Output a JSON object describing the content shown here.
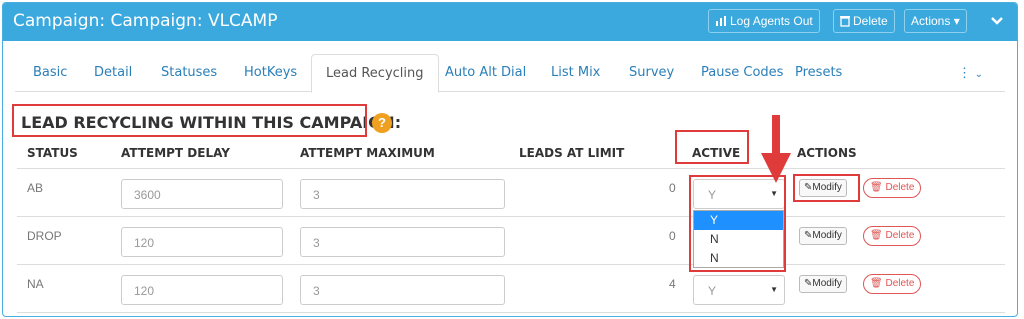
{
  "header": {
    "title": "Campaign: Campaign: VLCAMP",
    "log_agents_out": "Log Agents Out",
    "delete": "Delete",
    "actions": "Actions"
  },
  "tabs": [
    {
      "label": "Basic"
    },
    {
      "label": "Detail"
    },
    {
      "label": "Statuses"
    },
    {
      "label": "HotKeys"
    },
    {
      "label": "Lead Recycling"
    },
    {
      "label": "Auto Alt Dial"
    },
    {
      "label": "List Mix"
    },
    {
      "label": "Survey"
    },
    {
      "label": "Pause Codes"
    },
    {
      "label": "Presets"
    }
  ],
  "section": {
    "title": "LEAD RECYCLING WITHIN THIS CAMPAIGN:",
    "help": "?"
  },
  "table": {
    "headers": {
      "status": "STATUS",
      "attempt_delay": "ATTEMPT DELAY",
      "attempt_maximum": "ATTEMPT MAXIMUM",
      "leads_at_limit": "LEADS AT LIMIT",
      "active": "ACTIVE",
      "actions": "ACTIONS"
    },
    "rows": [
      {
        "status": "AB",
        "delay": "3600",
        "max": "3",
        "leads": "0",
        "active": "Y"
      },
      {
        "status": "DROP",
        "delay": "120",
        "max": "3",
        "leads": "0",
        "active": "Y"
      },
      {
        "status": "NA",
        "delay": "120",
        "max": "3",
        "leads": "4",
        "active": "Y"
      }
    ],
    "modify_label": "Modify",
    "delete_label": "Delete"
  },
  "dropdown": {
    "options": [
      "Y",
      "N",
      "N"
    ],
    "selected": "Y"
  },
  "colors": {
    "header_bg": "#3ba9de",
    "highlight": "#e03b3b",
    "selected_option": "#1e90ff"
  }
}
